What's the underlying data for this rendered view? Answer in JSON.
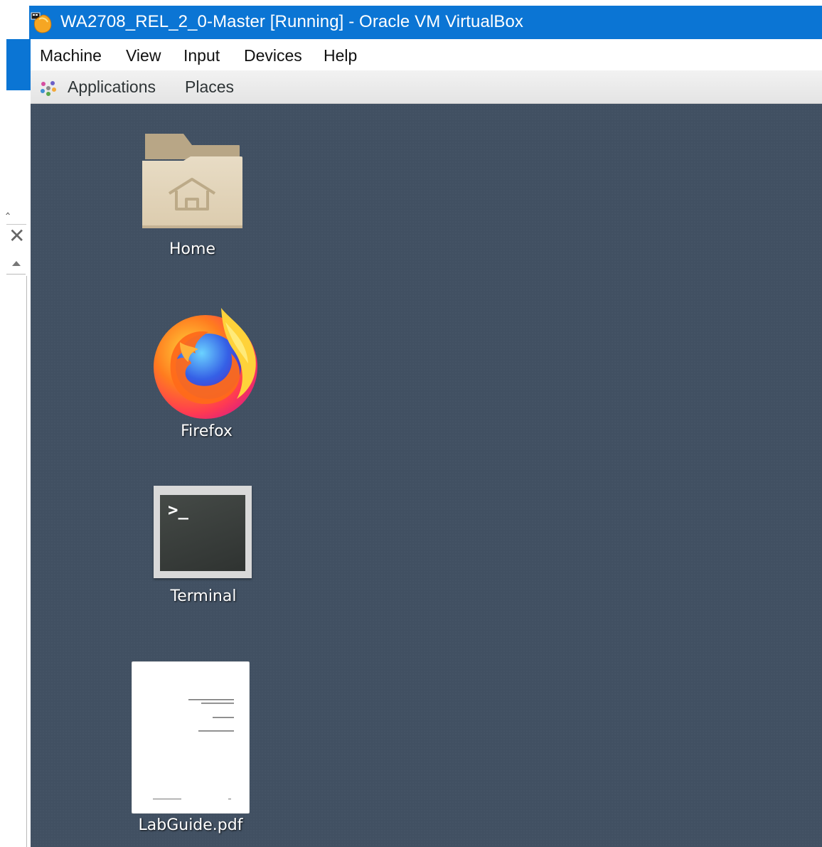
{
  "window": {
    "title": "WA2708_REL_2_0-Master [Running] - Oracle VM VirtualBox",
    "app_icon": "virtualbox-icon",
    "titlebar_color": "#0b75d4"
  },
  "menubar": {
    "items": [
      {
        "label": "Machine"
      },
      {
        "label": "View"
      },
      {
        "label": "Input"
      },
      {
        "label": "Devices"
      },
      {
        "label": "Help"
      }
    ]
  },
  "gnome_panel": {
    "applications_label": "Applications",
    "applications_icon": "applications-icon",
    "places_label": "Places"
  },
  "desktop": {
    "background_color": "#415062",
    "icons": [
      {
        "label": "Home",
        "icon": "home-folder-icon"
      },
      {
        "label": "Firefox",
        "icon": "firefox-icon"
      },
      {
        "label": "Terminal",
        "icon": "terminal-icon"
      },
      {
        "label": "LabGuide.pdf",
        "icon": "pdf-document-icon"
      }
    ]
  },
  "host_controls": {
    "collapse_icon": "chevron-up-icon",
    "close_icon": "close-icon",
    "scroll_up_icon": "scroll-up-arrow-icon"
  }
}
